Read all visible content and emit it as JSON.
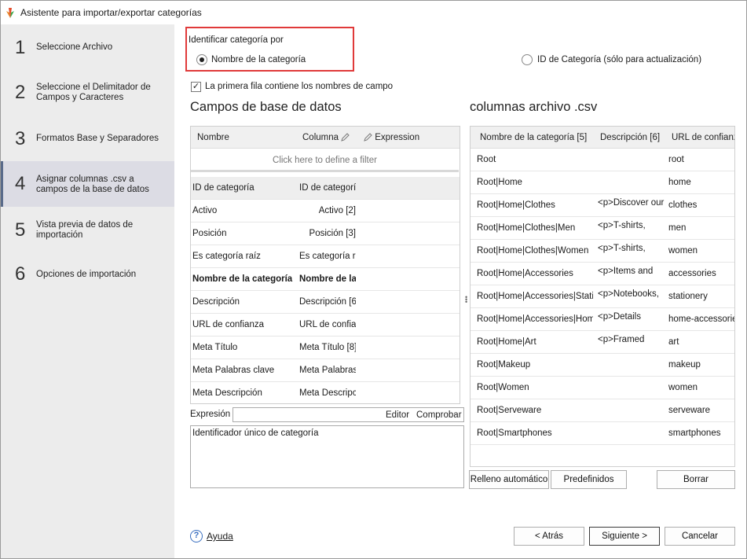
{
  "window": {
    "title": "Asistente para importar/exportar categorías"
  },
  "steps": [
    {
      "num": "1",
      "label": "Seleccione Archivo"
    },
    {
      "num": "2",
      "label": "Seleccione el Delimitador de Campos y Caracteres"
    },
    {
      "num": "3",
      "label": "Formatos Base y Separadores"
    },
    {
      "num": "4",
      "label": "Asignar columnas .csv a campos de la base de datos"
    },
    {
      "num": "5",
      "label": "Vista previa de datos de importación"
    },
    {
      "num": "6",
      "label": "Opciones de importación"
    }
  ],
  "identify": {
    "title": "Identificar categoría por",
    "option_name": "Nombre de la categoría",
    "option_id": "ID de Categoría (sólo para actualización)"
  },
  "first_row": {
    "label": "La primera fila contiene los nombres de campo",
    "checked": true
  },
  "db_fields": {
    "title": "Campos de base de datos",
    "col_name": "Nombre",
    "col_column": "Columna",
    "col_expression": "Expression",
    "filter_text": "Click here to define a filter",
    "rows": [
      {
        "name": "ID de categoría",
        "column": "ID de categoría"
      },
      {
        "name": "Activo",
        "column": "Activo [2]"
      },
      {
        "name": "Posición",
        "column": "Posición [3]"
      },
      {
        "name": "Es categoría raíz",
        "column": "Es categoría raíz"
      },
      {
        "name": "Nombre de la categoría",
        "column": "Nombre de la categoría"
      },
      {
        "name": "Descripción",
        "column": "Descripción [6]"
      },
      {
        "name": "URL de confianza",
        "column": "URL de confianza"
      },
      {
        "name": "Meta Título",
        "column": "Meta Título [8]"
      },
      {
        "name": "Meta Palabras clave",
        "column": "Meta Palabras clave"
      },
      {
        "name": "Meta Descripción",
        "column": "Meta Descripción"
      }
    ]
  },
  "expression": {
    "label": "Expresión",
    "editor": "Editor",
    "check": "Comprobar",
    "description": "Identificador único de categoría"
  },
  "csv": {
    "title": "columnas archivo .csv",
    "col1": "Nombre de la categoría [5]",
    "col2": "Descripción [6]",
    "col3": "URL de confianza",
    "rows": [
      {
        "name": "Root",
        "desc": "",
        "url": "root"
      },
      {
        "name": "Root|Home",
        "desc": "",
        "url": "home"
      },
      {
        "name": "Root|Home|Clothes",
        "desc": "<p>Discover our",
        "url": "clothes"
      },
      {
        "name": "Root|Home|Clothes|Men",
        "desc": "<p>T-shirts,",
        "url": "men"
      },
      {
        "name": "Root|Home|Clothes|Women",
        "desc": "<p>T-shirts,",
        "url": "women"
      },
      {
        "name": "Root|Home|Accessories",
        "desc": "<p>Items and",
        "url": "accessories"
      },
      {
        "name": "Root|Home|Accessories|Stationery",
        "desc": "<p>Notebooks,",
        "url": "stationery"
      },
      {
        "name": "Root|Home|Accessories|Home",
        "desc": "<p>Details",
        "url": "home-accessories"
      },
      {
        "name": "Root|Home|Art",
        "desc": "<p>Framed",
        "url": "art"
      },
      {
        "name": "Root|Makeup",
        "desc": "",
        "url": "makeup"
      },
      {
        "name": "Root|Women",
        "desc": "",
        "url": "women"
      },
      {
        "name": "Root|Serveware",
        "desc": "",
        "url": "serveware"
      },
      {
        "name": "Root|Smartphones",
        "desc": "",
        "url": "smartphones"
      }
    ],
    "buttons": {
      "autofill": "Relleno automático",
      "defaults": "Predefinidos",
      "clear": "Borrar"
    }
  },
  "footer": {
    "help": "Ayuda",
    "back": "< Atrás",
    "next": "Siguiente >",
    "cancel": "Cancelar"
  },
  "colors": {
    "highlight_border": "#e03a3a",
    "sidebar_bg": "#ececec",
    "active_step_bg": "#dcdce4"
  }
}
